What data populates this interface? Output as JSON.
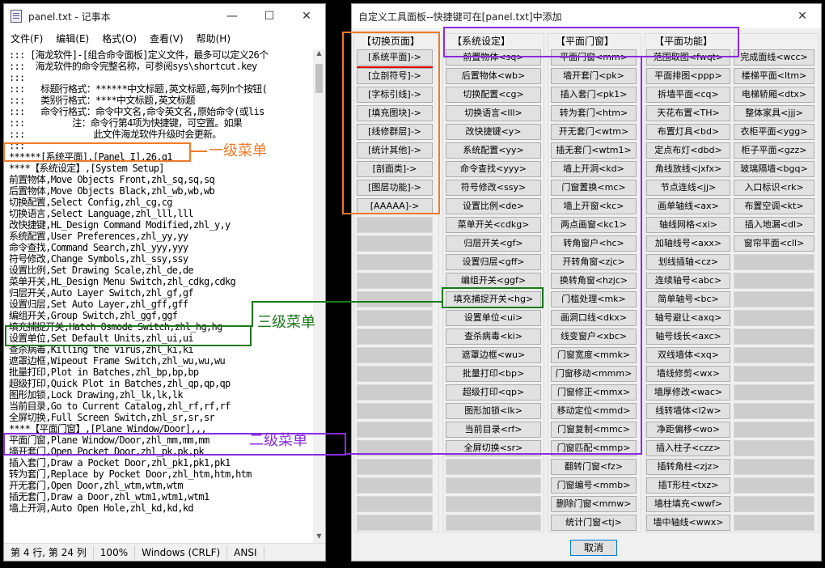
{
  "notepad": {
    "title": "panel.txt - 记事本",
    "menu": [
      "文件(F)",
      "编辑(E)",
      "格式(O)",
      "查看(V)",
      "帮助(H)"
    ],
    "lines": [
      "::: [海龙软件]-[组合命令面板]定义文件，最多可以定义26个",
      ":::  海龙软件的命令完整名称，可参阅sys\\shortcut.key",
      ":::",
      ":::   标题行格式：******中文标题,英文标题,每列n个按钮(",
      ":::   类别行格式：****中文标题,英文标题",
      ":::   命令行格式：命令中文名,命令英文名,原始命令(或lis",
      ":::         注：命令行第4项为快捷键，可空置。如果",
      ":::             此文件海龙软件升级时会更新。",
      ":::",
      "",
      "******[系统平面],[Panel I],26,q1",
      "",
      "****【系统设定】,[System Setup]",
      "前置物体,Move Objects Front,zhl_sq,sq,sq",
      "后置物体,Move Objects Black,zhl_wb,wb,wb",
      "切换配置,Select Config,zhl_cg,cg",
      "切换语言,Select Language,zhl_lll,lll",
      "改快捷键,HL_Design Command Modified,zhl_y,y",
      "系统配置,User Preferences,zhl_yy,yy",
      "命令查找,Command Search,zhl_yyy,yyy",
      "符号修改,Change Symbols,zhl_ssy,ssy",
      "设置比例,Set Drawing Scale,zhl_de,de",
      "菜单开关,HL_Design Menu Switch,zhl_cdkg,cdkg",
      "归层开关,Auto Layer Switch,zhl_gf,gf",
      "设置归层,Set Auto Layer,zhl_gff,gff",
      "编组开关,Group Switch,zhl_ggf,ggf",
      "填充捕捉开关,Hatch Osmode Switch,zhl_hg,hg",
      "设置单位,Set Default Units,zhl_ui,ui",
      "查杀病毒,Killing the virus,zhl_ki,ki",
      "遮罩边框,Wipeout Frame Switch,zhl_wu,wu,wu",
      "批量打印,Plot in Batches,zhl_bp,bp,bp",
      "超级打印,Quick Plot in Batches,zhl_qp,qp,qp",
      "图形加锁,Lock Drawing,zhl_lk,lk,lk",
      "当前目录,Go to Current Catalog,zhl_rf,rf,rf",
      "全屏切换,Full Screen Switch,zhl_sr,sr,sr",
      "",
      "****【平面门窗】,[Plane Window/Door],,,",
      "平面门窗,Plane Window/Door,zhl_mm,mm,mm",
      "墙开套门,Open Pocket Door,zhl_pk,pk,pk",
      "插入套门,Draw a Pocket Door,zhl_pk1,pk1,pk1",
      "转为套门,Replace by Pocket Door,zhl_htm,htm,htm",
      "开无套门,Open Door,zhl_wtm,wtm,wtm",
      "插无套门,Draw a Door,zhl_wtm1,wtm1,wtm1",
      "墙上开洞,Auto Open Hole,zhl_kd,kd,kd"
    ],
    "status": [
      "第 4 行, 第 24 列",
      "100%",
      "Windows (CRLF)",
      "ANSI"
    ]
  },
  "dialog": {
    "title": "自定义工具面板--快捷键可在[panel.txt]中添加",
    "cancel": "取消",
    "col0": {
      "header": "【切换页面】",
      "items": [
        "[系统平面]->",
        "[立剖符号]->",
        "[字标引线]->",
        "[填充图块]->",
        "[线修群层]->",
        "[统计其他]->",
        "[剖面类]->",
        "[图层功能]->",
        "[AAAAA]->"
      ]
    },
    "col1": {
      "header": "【系统设定】",
      "items": [
        "前置物体<sq>",
        "后置物体<wb>",
        "切换配置<cg>",
        "切换语言<lll>",
        "改快捷键<y>",
        "系统配置<yy>",
        "命令查找<yyy>",
        "符号修改<ssy>",
        "设置比例<de>",
        "菜单开关<cdkg>",
        "归层开关<gf>",
        "设置归层<gff>",
        "编组开关<ggf>",
        "填充捕捉开关<hg>",
        "设置单位<ui>",
        "查杀病毒<ki>",
        "遮罩边框<wu>",
        "批量打印<bp>",
        "超级打印<qp>",
        "图形加锁<lk>",
        "当前目录<rf>",
        "全屏切换<sr>"
      ]
    },
    "col2": {
      "header": "【平面门窗】",
      "items": [
        "平面门窗<mm>",
        "墙开套门<pk>",
        "插入套门<pk1>",
        "转为套门<htm>",
        "开无套门<wtm>",
        "插无套门<wtm1>",
        "墙上开洞<kd>",
        "门窗置换<mc>",
        "墙上开窗<kc>",
        "两点画窗<kc1>",
        "转角窗户<hc>",
        "开转角窗<zjc>",
        "换转角窗<hzjc>",
        "门槛处理<mk>",
        "画洞口线<dkx>",
        "线变窗户<xbc>",
        "门窗宽度<mmk>",
        "门窗移动<mmm>",
        "门窗修正<mmx>",
        "移动定位<mmd>",
        "门窗复制<mmc>",
        "门窗匹配<mmp>",
        "翻转门窗<fz>",
        "门窗编号<mmb>",
        "删除门窗<mmw>",
        "统计门窗<tj>"
      ]
    },
    "col3": {
      "header": "【平面功能】",
      "items": [
        "范围取图<fwqt>",
        "平面排图<ppp>",
        "拆墙平面<cq>",
        "天花布置<TH>",
        "布置灯具<bd>",
        "定点布灯<dbd>",
        "角线放线<jxfx>",
        "节点连线<jj>",
        "画单轴线<ax>",
        "轴线网格<xi>",
        "加轴线号<axx>",
        "划线插轴<cz>",
        "连续轴号<abc>",
        "简单轴号<bc>",
        "轴号避让<axq>",
        "轴号线长<axc>",
        "双线墙体<xq>",
        "墙线修剪<wx>",
        "墙厚修改<wac>",
        "线转墙体<l2w>",
        "净距偏移<wo>",
        "插入柱子<czz>",
        "插转角柱<zjz>",
        "插T形柱<txz>",
        "墙柱填充<wwf>",
        "墙中轴线<wwx>"
      ]
    },
    "col4": {
      "items": [
        "完成面线<wcc>",
        "楼梯平面<ltm>",
        "电梯轿厢<dtx>",
        "整体家具<jjj>",
        "衣柜平面<ygg>",
        "柜子平面<gzz>",
        "玻璃隔墙<bgq>",
        "入口标识<rk>",
        "布置空调<kt>",
        "插入地漏<dl>",
        "窗帘平面<cll>"
      ]
    }
  },
  "annotations": {
    "level1": "一级菜单",
    "level2": "二级菜单",
    "level3": "三级菜单"
  },
  "colors": {
    "orange": "#f07a2a",
    "green": "#1a7a1a",
    "purple": "#8a2be2"
  }
}
